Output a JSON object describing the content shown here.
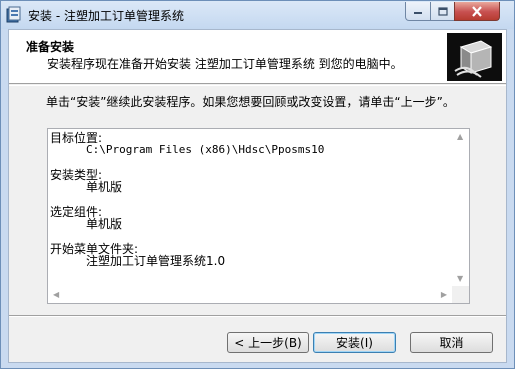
{
  "window": {
    "title": "安装 - 注塑加工订单管理系统",
    "caption_icons": [
      "minimize-icon",
      "maximize-icon",
      "close-icon"
    ]
  },
  "header": {
    "title": "准备安装",
    "subtitle": "安装程序现在准备开始安装 注塑加工订单管理系统 到您的电脑中。"
  },
  "intro": {
    "text": "单击“安装”继续此安装程序。如果您想要回顾或改变设置，请单击“上一步”。"
  },
  "summary": {
    "dest_label": "目标位置:",
    "dest_value": "C:\\Program Files (x86)\\Hdsc\\Pposms10",
    "type_label": "安装类型:",
    "type_value": "单机版",
    "components_label": "选定组件:",
    "components_value": "单机版",
    "startmenu_label": "开始菜单文件夹:",
    "startmenu_value": "注塑加工订单管理系统1.0"
  },
  "buttons": {
    "back": "< 上一步(B)",
    "install": "安装(I)",
    "cancel": "取消"
  },
  "colors": {
    "close_button": "#c75050",
    "titlebar": "#c4d8f0",
    "client_bg": "#f0f0f0"
  }
}
